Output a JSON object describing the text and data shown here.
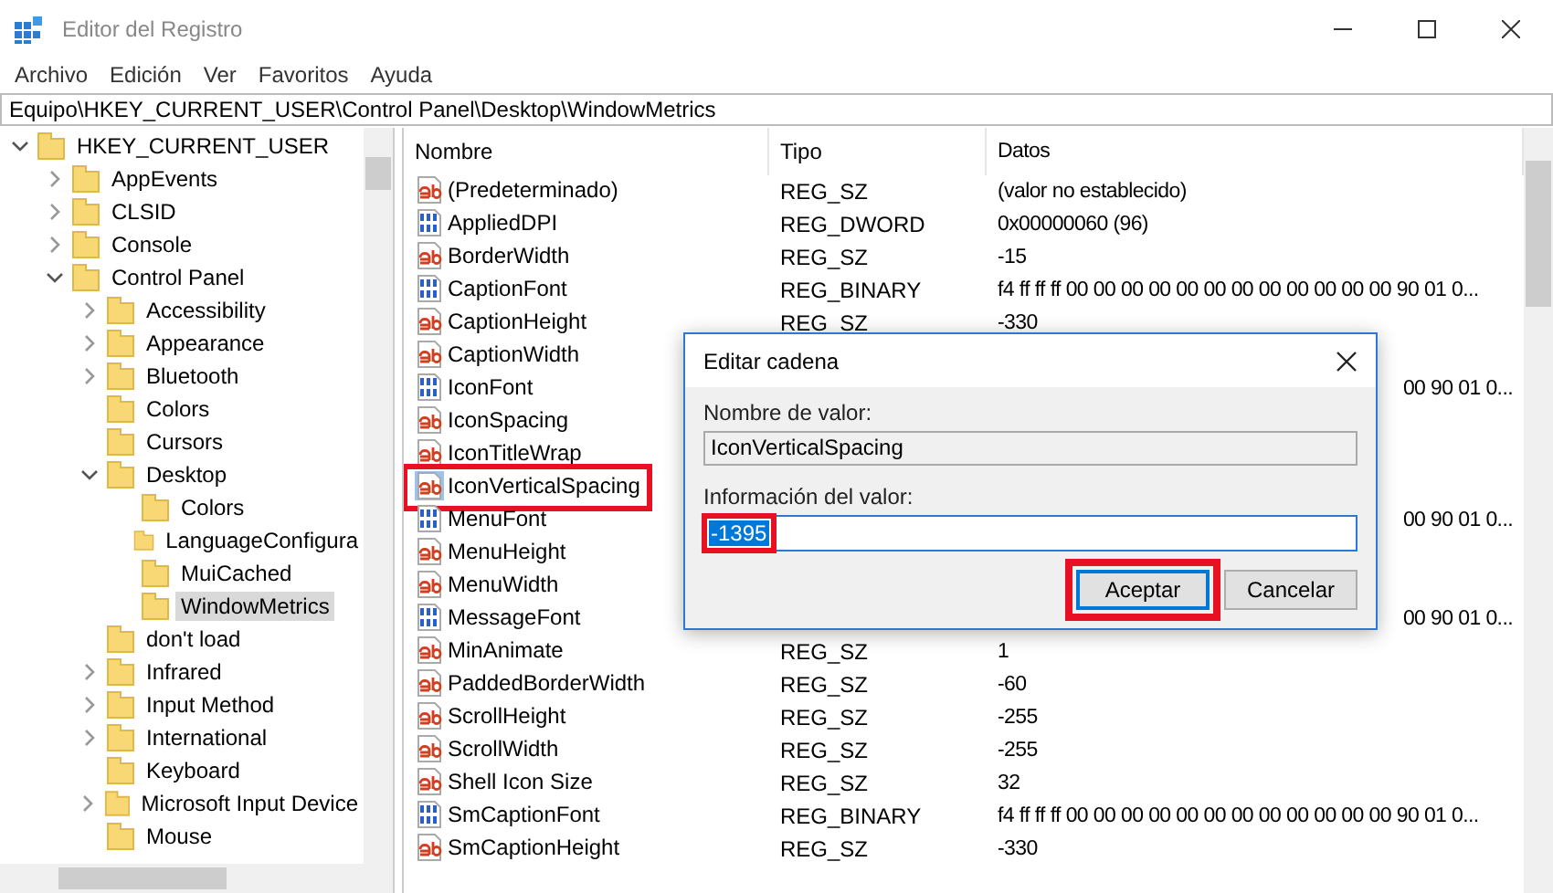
{
  "window": {
    "title": "Editor del Registro"
  },
  "menu": [
    "Archivo",
    "Edición",
    "Ver",
    "Favoritos",
    "Ayuda"
  ],
  "address": "Equipo\\HKEY_CURRENT_USER\\Control Panel\\Desktop\\WindowMetrics",
  "tree": [
    {
      "label": "HKEY_CURRENT_USER",
      "expandable": true,
      "expanded": true,
      "selected": false,
      "children": [
        {
          "label": "AppEvents",
          "expandable": true,
          "expanded": false,
          "selected": false
        },
        {
          "label": "CLSID",
          "expandable": true,
          "expanded": false,
          "selected": false
        },
        {
          "label": "Console",
          "expandable": true,
          "expanded": false,
          "selected": false
        },
        {
          "label": "Control Panel",
          "expandable": true,
          "expanded": true,
          "selected": false,
          "children": [
            {
              "label": "Accessibility",
              "expandable": true,
              "expanded": false,
              "selected": false
            },
            {
              "label": "Appearance",
              "expandable": true,
              "expanded": false,
              "selected": false
            },
            {
              "label": "Bluetooth",
              "expandable": true,
              "expanded": false,
              "selected": false
            },
            {
              "label": "Colors",
              "expandable": false,
              "expanded": false,
              "selected": false
            },
            {
              "label": "Cursors",
              "expandable": false,
              "expanded": false,
              "selected": false
            },
            {
              "label": "Desktop",
              "expandable": true,
              "expanded": true,
              "selected": false,
              "children": [
                {
                  "label": "Colors",
                  "expandable": false,
                  "expanded": false,
                  "selected": false
                },
                {
                  "label": "LanguageConfigura",
                  "expandable": false,
                  "expanded": false,
                  "selected": false
                },
                {
                  "label": "MuiCached",
                  "expandable": false,
                  "expanded": false,
                  "selected": false
                },
                {
                  "label": "WindowMetrics",
                  "expandable": false,
                  "expanded": false,
                  "selected": true
                }
              ]
            },
            {
              "label": "don't load",
              "expandable": false,
              "expanded": false,
              "selected": false
            },
            {
              "label": "Infrared",
              "expandable": true,
              "expanded": false,
              "selected": false
            },
            {
              "label": "Input Method",
              "expandable": true,
              "expanded": false,
              "selected": false
            },
            {
              "label": "International",
              "expandable": true,
              "expanded": false,
              "selected": false
            },
            {
              "label": "Keyboard",
              "expandable": false,
              "expanded": false,
              "selected": false
            },
            {
              "label": "Microsoft Input Device",
              "expandable": true,
              "expanded": false,
              "selected": false
            },
            {
              "label": "Mouse",
              "expandable": false,
              "expanded": false,
              "selected": false
            }
          ]
        }
      ]
    }
  ],
  "table": {
    "columns": [
      "Nombre",
      "Tipo",
      "Datos"
    ],
    "rows": [
      {
        "kind": "string",
        "name": "(Predeterminado)",
        "type": "REG_SZ",
        "data": "(valor no establecido)",
        "selected": false,
        "highlighted": false
      },
      {
        "kind": "binary",
        "name": "AppliedDPI",
        "type": "REG_DWORD",
        "data": "0x00000060 (96)",
        "selected": false,
        "highlighted": false
      },
      {
        "kind": "string",
        "name": "BorderWidth",
        "type": "REG_SZ",
        "data": "-15",
        "selected": false,
        "highlighted": false
      },
      {
        "kind": "binary",
        "name": "CaptionFont",
        "type": "REG_BINARY",
        "data": "f4 ff ff ff 00 00 00 00 00 00 00 00 00 00 00 00 90 01 0...",
        "selected": false,
        "highlighted": false
      },
      {
        "kind": "string",
        "name": "CaptionHeight",
        "type": "REG_SZ",
        "data": "-330",
        "selected": false,
        "highlighted": false
      },
      {
        "kind": "string",
        "name": "CaptionWidth",
        "selected": false,
        "highlighted": false
      },
      {
        "kind": "binary",
        "name": "IconFont",
        "data_tail": "00 90 01 0...",
        "selected": false,
        "highlighted": false
      },
      {
        "kind": "string",
        "name": "IconSpacing",
        "selected": false,
        "highlighted": false
      },
      {
        "kind": "string",
        "name": "IconTitleWrap",
        "selected": false,
        "highlighted": false
      },
      {
        "kind": "string",
        "name": "IconVerticalSpacing",
        "selected": true,
        "highlighted": true
      },
      {
        "kind": "binary",
        "name": "MenuFont",
        "data_tail": "00 90 01 0...",
        "selected": false,
        "highlighted": false
      },
      {
        "kind": "string",
        "name": "MenuHeight",
        "selected": false,
        "highlighted": false
      },
      {
        "kind": "string",
        "name": "MenuWidth",
        "selected": false,
        "highlighted": false
      },
      {
        "kind": "binary",
        "name": "MessageFont",
        "data_tail": "00 90 01 0...",
        "selected": false,
        "highlighted": false
      },
      {
        "kind": "string",
        "name": "MinAnimate",
        "type": "REG_SZ",
        "data": "1",
        "selected": false,
        "highlighted": false
      },
      {
        "kind": "string",
        "name": "PaddedBorderWidth",
        "type": "REG_SZ",
        "data": "-60",
        "selected": false,
        "highlighted": false
      },
      {
        "kind": "string",
        "name": "ScrollHeight",
        "type": "REG_SZ",
        "data": "-255",
        "selected": false,
        "highlighted": false
      },
      {
        "kind": "string",
        "name": "ScrollWidth",
        "type": "REG_SZ",
        "data": "-255",
        "selected": false,
        "highlighted": false
      },
      {
        "kind": "string",
        "name": "Shell Icon Size",
        "type": "REG_SZ",
        "data": "32",
        "selected": false,
        "highlighted": false
      },
      {
        "kind": "binary",
        "name": "SmCaptionFont",
        "type": "REG_BINARY",
        "data": "f4 ff ff ff 00 00 00 00 00 00 00 00 00 00 00 00 90 01 0...",
        "selected": false,
        "highlighted": false
      },
      {
        "kind": "string",
        "name": "SmCaptionHeight",
        "type": "REG_SZ",
        "data": "-330",
        "selected": false,
        "highlighted": false
      }
    ]
  },
  "dialog": {
    "title": "Editar cadena",
    "name_label": "Nombre de valor:",
    "name_value": "IconVerticalSpacing",
    "data_label": "Información del valor:",
    "data_value": "-1395",
    "data_value_highlighted": true,
    "buttons": [
      {
        "label": "Aceptar",
        "default": true,
        "highlighted": true
      },
      {
        "label": "Cancelar",
        "default": false,
        "highlighted": false
      }
    ]
  }
}
